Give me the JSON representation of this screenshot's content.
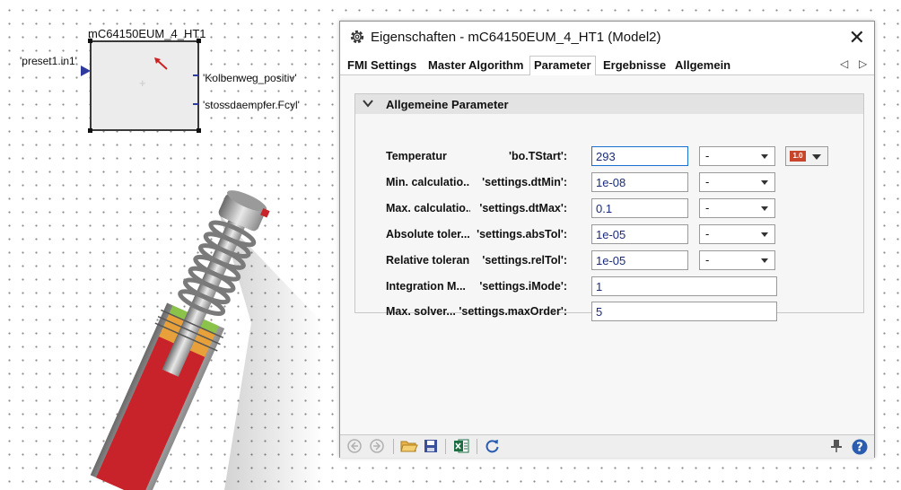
{
  "canvas": {
    "block_title": "mC64150EUM_4_HT1",
    "input_label": "'preset1.in1'",
    "output_labels": [
      "'Kolbenweg_positiv'",
      "'stossdaempfer.Fcyl'"
    ]
  },
  "dialog": {
    "title": "Eigenschaften - mC64150EUM_4_HT1 (Model2)",
    "icons": {
      "title": "gear-icon",
      "close": "close-icon"
    },
    "tabs": [
      {
        "label": "FMI Settings"
      },
      {
        "label": "Master Algorithm"
      },
      {
        "label": "Parameter",
        "active": true
      },
      {
        "label": "Ergebnisse"
      },
      {
        "label": "Allgemein"
      }
    ],
    "group_title": "Allgemeine Parameter",
    "type_badge": "1.0",
    "params": [
      {
        "label": "Temperatur",
        "name": "'bo.TStart':",
        "value": "293",
        "unit": "-"
      },
      {
        "label": "Min. calculatio...",
        "name": "'settings.dtMin':",
        "value": "1e-08",
        "unit": "-"
      },
      {
        "label": "Max. calculatio...",
        "name": "'settings.dtMax':",
        "value": "0.1",
        "unit": "-"
      },
      {
        "label": "Absolute toler...",
        "name": "'settings.absTol':",
        "value": "1e-05",
        "unit": "-"
      },
      {
        "label": "Relative toleran...",
        "name": "'settings.relTol':",
        "value": "1e-05",
        "unit": "-"
      },
      {
        "label": "Integration M...",
        "name": "'settings.iMode':",
        "value": "1"
      },
      {
        "label": "Max. solver...",
        "name": "'settings.maxOrder':",
        "value": "5"
      }
    ],
    "bottom_icons": [
      "back-icon",
      "forward-icon",
      "open-folder-icon",
      "save-icon",
      "excel-icon",
      "refresh-icon",
      "pin-icon",
      "help-icon"
    ]
  },
  "colors": {
    "port": "#2f3a9e",
    "focus": "#1a6fd0",
    "badge": "#c8442a",
    "value_text": "#1b2b7a"
  }
}
